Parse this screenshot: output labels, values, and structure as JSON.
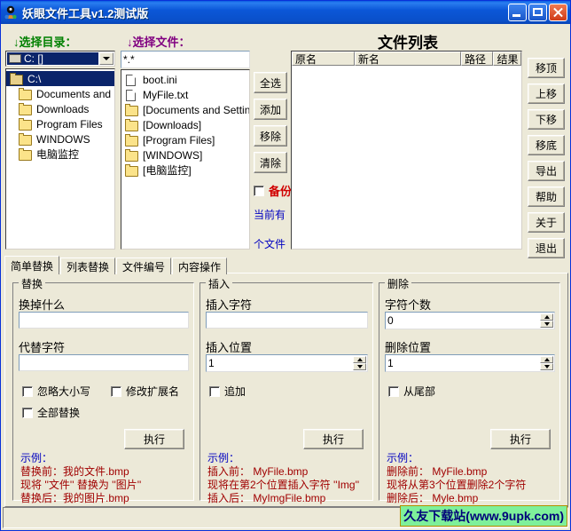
{
  "window": {
    "title": "妖眼文件工具v1.2测试版",
    "icon": "app-eye-icon",
    "minimize": "−",
    "maximize": "□",
    "close": "×"
  },
  "colors": {
    "titlebar": "#0b57d8",
    "dir_header": "#008000",
    "file_header": "#800080",
    "backup_label": "#d00000",
    "status_text": "#0000c0",
    "sample_title": "#0000c0",
    "sample_line": "#a00000",
    "watermark_bg": "#7ef09a",
    "watermark_fg": "#00007a",
    "face": "#ece9d8"
  },
  "dir_panel": {
    "header": "↓选择目录：",
    "drive_combo": {
      "value": "C: []",
      "icon": "drive-icon",
      "chevron": "chevron-down-icon"
    },
    "tree": [
      {
        "label": "C:\\",
        "icon": "folder-open-icon",
        "selected": true,
        "indent": 0
      },
      {
        "label": "Documents and Se",
        "icon": "folder-icon",
        "selected": false,
        "indent": 1
      },
      {
        "label": "Downloads",
        "icon": "folder-icon",
        "selected": false,
        "indent": 1
      },
      {
        "label": "Program Files",
        "icon": "folder-icon",
        "selected": false,
        "indent": 1
      },
      {
        "label": "WINDOWS",
        "icon": "folder-icon",
        "selected": false,
        "indent": 1
      },
      {
        "label": "电脑监控",
        "icon": "folder-icon",
        "selected": false,
        "indent": 1
      }
    ]
  },
  "file_panel": {
    "header": "↓选择文件：",
    "filter_value": "*.*",
    "items": [
      {
        "label": "boot.ini",
        "icon": "file-icon"
      },
      {
        "label": "MyFile.txt",
        "icon": "file-icon"
      },
      {
        "label": "[Documents and Settings]",
        "icon": "folder-icon"
      },
      {
        "label": "[Downloads]",
        "icon": "folder-icon"
      },
      {
        "label": "[Program Files]",
        "icon": "folder-icon"
      },
      {
        "label": "[WINDOWS]",
        "icon": "folder-icon"
      },
      {
        "label": "[电脑监控]",
        "icon": "folder-icon"
      }
    ]
  },
  "mid_buttons": [
    {
      "label": "全选",
      "name": "select-all-button"
    },
    {
      "label": "添加",
      "name": "add-button"
    },
    {
      "label": "移除",
      "name": "remove-button"
    },
    {
      "label": "清除",
      "name": "clear-button"
    }
  ],
  "backup": {
    "label": "备份",
    "checked": false
  },
  "status": {
    "line1": "当前有",
    "line2": "个文件"
  },
  "list_panel": {
    "title": "文件列表",
    "columns": [
      "原名",
      "新名",
      "路径",
      "结果"
    ],
    "rows": []
  },
  "side_buttons": [
    {
      "label": "移顶",
      "name": "move-top-button"
    },
    {
      "label": "上移",
      "name": "move-up-button"
    },
    {
      "label": "下移",
      "name": "move-down-button"
    },
    {
      "label": "移底",
      "name": "move-bottom-button"
    },
    {
      "label": "导出",
      "name": "export-button"
    },
    {
      "label": "帮助",
      "name": "help-button"
    },
    {
      "label": "关于",
      "name": "about-button"
    },
    {
      "label": "退出",
      "name": "exit-button"
    }
  ],
  "tabs": [
    {
      "label": "简单替换",
      "active": true
    },
    {
      "label": "列表替换",
      "active": false
    },
    {
      "label": "文件编号",
      "active": false
    },
    {
      "label": "内容操作",
      "active": false
    }
  ],
  "replace_group": {
    "title": "替换",
    "field1_label": "换掉什么",
    "field1_value": "",
    "field2_label": "代替字符",
    "field2_value": "",
    "check_ignore_case": "忽略大小写",
    "check_modify_ext": "修改扩展名",
    "check_replace_all": "全部替换",
    "exec_label": "执行",
    "sample_title": "示例：",
    "sample_lines": [
      "替换前：我的文件.bmp",
      "现将 ''文件'' 替换为 ''图片''",
      "替换后：我的图片.bmp"
    ]
  },
  "insert_group": {
    "title": "插入",
    "field1_label": "插入字符",
    "field1_value": "",
    "field2_label": "插入位置",
    "field2_value": "1",
    "check_append": "追加",
    "exec_label": "执行",
    "sample_title": "示例：",
    "sample_lines": [
      "插入前： MyFile.bmp",
      "现将在第2个位置插入字符 ''Img''",
      "插入后： MyImgFile.bmp"
    ]
  },
  "delete_group": {
    "title": "删除",
    "field1_label": "字符个数",
    "field1_value": "0",
    "field2_label": "删除位置",
    "field2_value": "1",
    "check_from_tail": "从尾部",
    "exec_label": "执行",
    "sample_title": "示例：",
    "sample_lines": [
      "删除前： MyFile.bmp",
      "现将从第3个位置删除2个字符",
      "删除后： Myle.bmp"
    ]
  },
  "watermark": "久友下载站(www.9upk.com)"
}
